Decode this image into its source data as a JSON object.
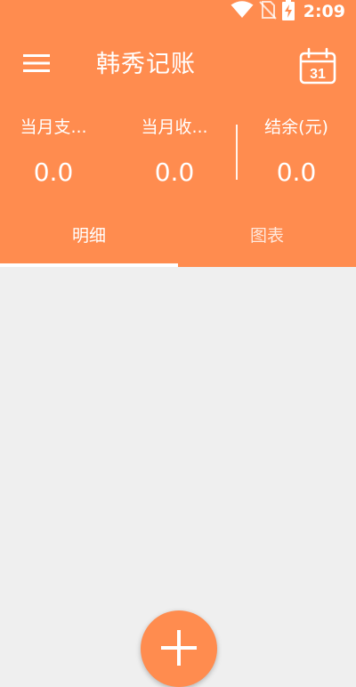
{
  "status_bar": {
    "time": "2:09",
    "icons": [
      "wifi-icon",
      "no-sim-icon",
      "battery-charging-icon"
    ]
  },
  "toolbar": {
    "title": "韩秀记账",
    "menu_icon": "menu-icon",
    "calendar_icon": "calendar-icon",
    "calendar_day": "31"
  },
  "summary": {
    "expense_label": "当月支...",
    "expense_value": "0.0",
    "income_label": "当月收...",
    "income_value": "0.0",
    "balance_label": "结余(元)",
    "balance_value": "0.0"
  },
  "tabs": [
    {
      "label": "明细",
      "active": true
    },
    {
      "label": "图表",
      "active": false
    }
  ],
  "fab": {
    "icon": "plus-icon"
  },
  "colors": {
    "primary": "#ff8c4f",
    "background": "#efefef",
    "text_on_primary": "#ffffff"
  }
}
